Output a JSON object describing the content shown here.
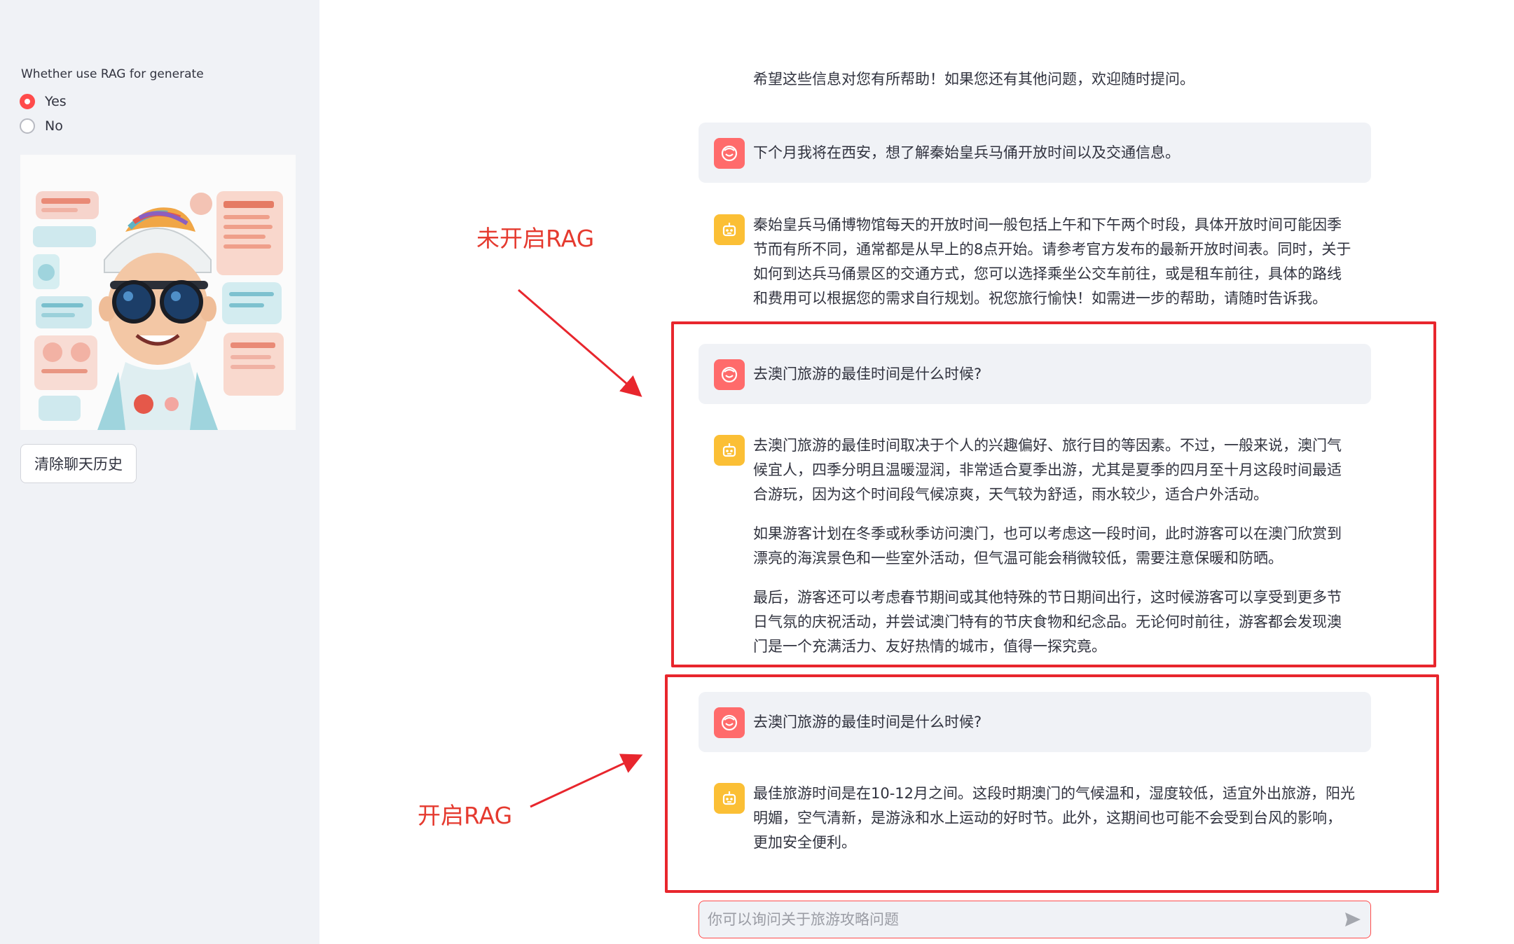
{
  "sidebar": {
    "rag_label": "Whether use RAG for generate",
    "options": [
      {
        "label": "Yes",
        "selected": true
      },
      {
        "label": "No",
        "selected": false
      }
    ],
    "clear_button": "清除聊天历史"
  },
  "chat": {
    "top_text": "希望这些信息对您有所帮助！如果您还有其他问题，欢迎随时提问。",
    "messages": [
      {
        "role": "user",
        "text": "下个月我将在西安，想了解秦始皇兵马俑开放时间以及交通信息。"
      },
      {
        "role": "assistant",
        "lines": [
          "秦始皇兵马俑博物馆每天的开放时间一般包括上午和下午两个时段，具体开放时间可能因季",
          "节而有所不同，通常都是从早上的8点开始。请参考官方发布的最新开放时间表。同时，关于",
          "如何到达兵马俑景区的交通方式，您可以选择乘坐公交车前往，或是租车前往，具体的路线",
          "和费用可以根据您的需求自行规划。祝您旅行愉快！如需进一步的帮助，请随时告诉我。"
        ]
      },
      {
        "role": "user",
        "text": "去澳门旅游的最佳时间是什么时候?"
      },
      {
        "role": "assistant",
        "paragraphs": [
          [
            "去澳门旅游的最佳时间取决于个人的兴趣偏好、旅行目的等因素。不过，一般来说，澳门气",
            "候宜人，四季分明且温暖湿润，非常适合夏季出游，尤其是夏季的四月至十月这段时间最适",
            "合游玩，因为这个时间段气候凉爽，天气较为舒适，雨水较少，适合户外活动。"
          ],
          [
            "如果游客计划在冬季或秋季访问澳门，也可以考虑这一段时间，此时游客可以在澳门欣赏到",
            "漂亮的海滨景色和一些室外活动，但气温可能会稍微较低，需要注意保暖和防晒。"
          ],
          [
            "最后，游客还可以考虑春节期间或其他特殊的节日期间出行，这时候游客可以享受到更多节",
            "日气氛的庆祝活动，并尝试澳门特有的节庆食物和纪念品。无论何时前往，游客都会发现澳",
            "门是一个充满活力、友好热情的城市，值得一探究竟。"
          ]
        ]
      },
      {
        "role": "user",
        "text": "去澳门旅游的最佳时间是什么时候?"
      },
      {
        "role": "assistant",
        "lines": [
          "最佳旅游时间是在10-12月之间。这段时期澳门的气候温和，湿度较低，适宜外出旅游，阳光",
          "明媚，空气清新，是游泳和水上运动的好时节。此外，这期间也可能不会受到台风的影响，",
          "更加安全便利。"
        ]
      }
    ],
    "input_placeholder": "你可以询问关于旅游攻略问题"
  },
  "annotations": {
    "no_rag": "未开启RAG",
    "with_rag": "开启RAG"
  },
  "colors": {
    "accent": "#ff4b4b",
    "annotation_red": "#e8262d",
    "user_avatar": "#ff6b6b",
    "bot_avatar": "#fbbf35",
    "sidebar_bg": "#f0f2f6"
  }
}
